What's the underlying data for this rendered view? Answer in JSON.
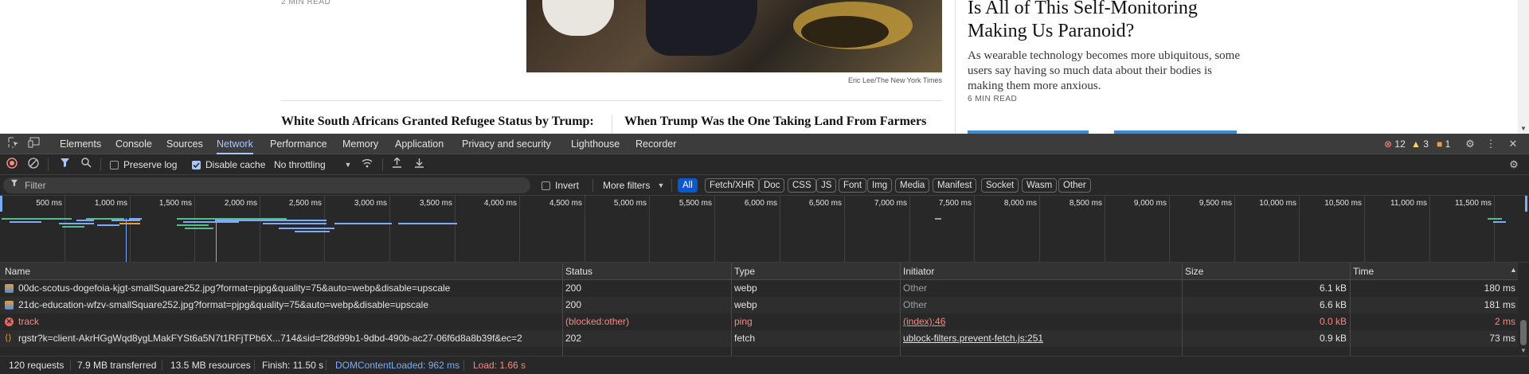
{
  "page": {
    "top_read_time": "2 MIN READ",
    "photo_credit": "Eric Lee/The New York Times",
    "headline_a": "White South Africans Granted Refugee Status by Trump:",
    "headline_b": "When Trump Was the One Taking Land From Farmers",
    "big_title": "Is All of This Self-Monitoring Making Us Paranoid?",
    "summary": "As wearable technology becomes more ubiquitous, some users say having so much data about their bodies is making them more anxious.",
    "read_time": "6 MIN READ"
  },
  "devtools": {
    "tabs": [
      "Elements",
      "Console",
      "Sources",
      "Network",
      "Performance",
      "Memory",
      "Application",
      "Privacy and security",
      "Lighthouse",
      "Recorder"
    ],
    "active_tab": "Network",
    "errors": "12",
    "warnings": "3",
    "infos": "1",
    "toolbar": {
      "preserve_log": "Preserve log",
      "disable_cache": "Disable cache",
      "throttling": "No throttling"
    },
    "filter": {
      "placeholder": "Filter",
      "invert": "Invert",
      "more_filters": "More filters",
      "chips": [
        "All",
        "Fetch/XHR",
        "Doc",
        "CSS",
        "JS",
        "Font",
        "Img",
        "Media",
        "Manifest",
        "Socket",
        "Wasm",
        "Other"
      ]
    },
    "timeline_ticks": [
      "500 ms",
      "1,000 ms",
      "1,500 ms",
      "2,000 ms",
      "2,500 ms",
      "3,000 ms",
      "3,500 ms",
      "4,000 ms",
      "4,500 ms",
      "5,000 ms",
      "5,500 ms",
      "6,000 ms",
      "6,500 ms",
      "7,000 ms",
      "7,500 ms",
      "8,000 ms",
      "8,500 ms",
      "9,000 ms",
      "9,500 ms",
      "10,000 ms",
      "10,500 ms",
      "11,000 ms",
      "11,500 ms"
    ],
    "columns": [
      "Name",
      "Status",
      "Type",
      "Initiator",
      "Size",
      "Time"
    ],
    "rows": [
      {
        "name": "00dc-scotus-dogefoia-kjgt-smallSquare252.jpg?format=pjpg&quality=75&auto=webp&disable=upscale",
        "status": "200",
        "type": "webp",
        "initiator": "Other",
        "size": "6.1 kB",
        "time": "180 ms"
      },
      {
        "name": "21dc-education-wfzv-smallSquare252.jpg?format=pjpg&quality=75&auto=webp&disable=upscale",
        "status": "200",
        "type": "webp",
        "initiator": "Other",
        "size": "6.6 kB",
        "time": "181 ms"
      },
      {
        "name": "track",
        "status": "(blocked:other)",
        "type": "ping",
        "initiator": "(index):46",
        "size": "0.0 kB",
        "time": "2 ms"
      },
      {
        "name": "rgstr?k=client-AkrHGgWqd8ygLMakFYSt6a5N7t1RFjTPb6X...714&sid=f28d99b1-9dbd-490b-ac27-06f6d8a8b39f&ec=2",
        "status": "202",
        "type": "fetch",
        "initiator": "ublock-filters.prevent-fetch.js:251",
        "size": "0.9 kB",
        "time": "73 ms"
      }
    ],
    "status": {
      "requests": "120 requests",
      "transferred": "7.9 MB transferred",
      "resources": "13.5 MB resources",
      "finish": "Finish: 11.50 s",
      "dcl": "DOMContentLoaded: 962 ms",
      "load": "Load: 1.66 s"
    }
  }
}
